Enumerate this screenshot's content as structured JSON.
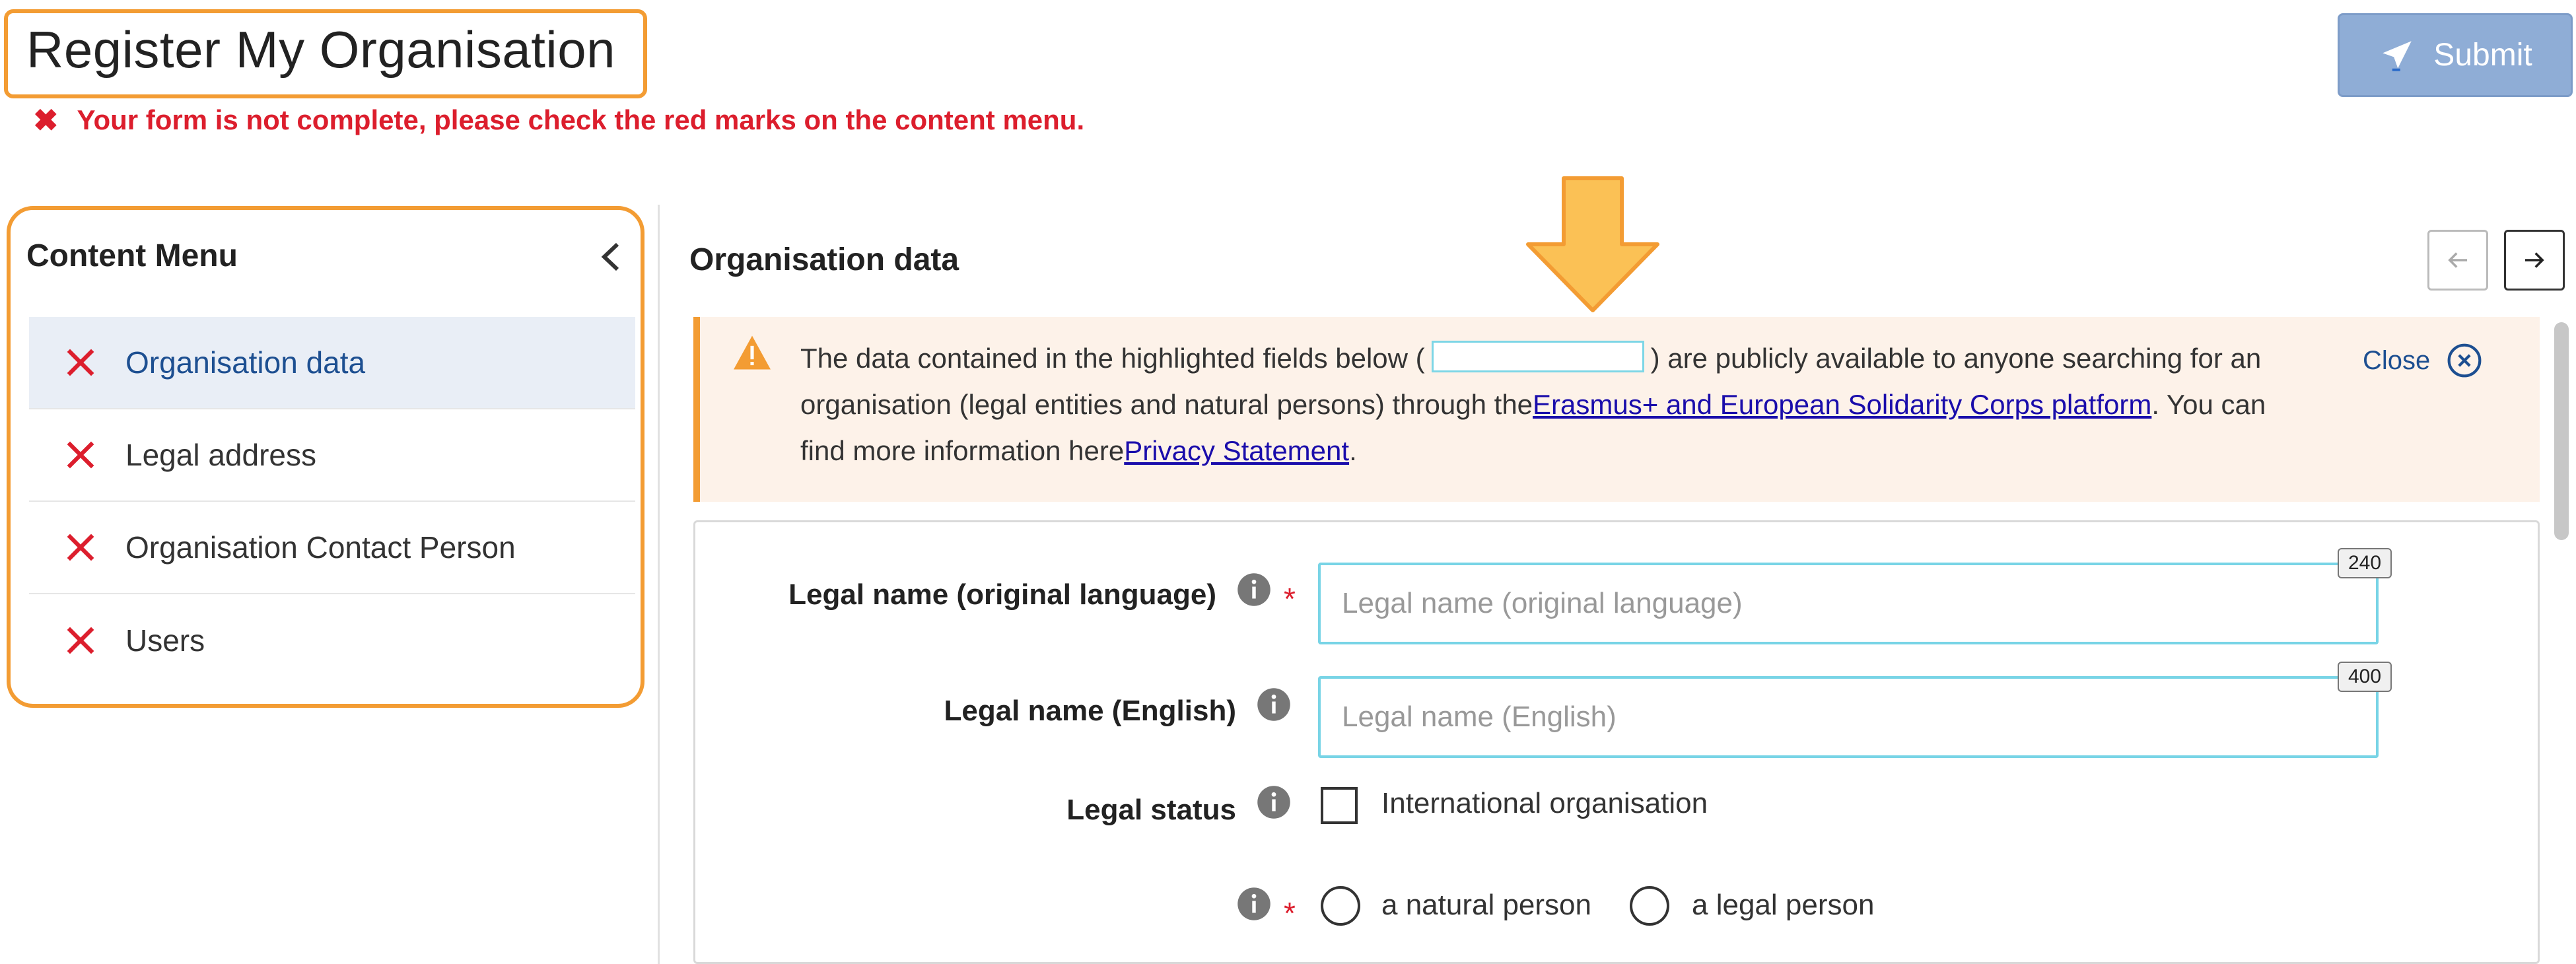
{
  "header": {
    "title": "Register My Organisation",
    "submit_label": "Submit",
    "error_message": "Your form is not complete, please check the red marks on the content menu."
  },
  "sidebar": {
    "title": "Content Menu",
    "items": [
      {
        "label": "Organisation data",
        "active": true
      },
      {
        "label": "Legal address",
        "active": false
      },
      {
        "label": "Organisation Contact Person",
        "active": false
      },
      {
        "label": "Users",
        "active": false
      }
    ]
  },
  "main": {
    "section_title": "Organisation data",
    "notice": {
      "text_before": "The data contained in the highlighted fields below (",
      "text_middle": ") are publicly available to anyone searching for an organisation (legal entities and natural persons) through the",
      "link_platform": "Erasmus+ and European Solidarity Corps platform",
      "text_after": ". You can find more information here",
      "link_privacy": "Privacy Statement",
      "text_end": ".",
      "close_label": "Close"
    },
    "form": {
      "legal_name_original": {
        "label": "Legal name (original language)",
        "placeholder": "Legal name (original language)",
        "counter": "240"
      },
      "legal_name_english": {
        "label": "Legal name (English)",
        "placeholder": "Legal name (English)",
        "counter": "400"
      },
      "legal_status": {
        "label": "Legal status",
        "checkbox_label": "International organisation"
      },
      "person_type": {
        "option_natural": "a natural person",
        "option_legal": "a legal person"
      }
    }
  },
  "colors": {
    "highlight_orange": "#f39c33",
    "error_red": "#dc1e2d",
    "submit_blue": "#8fadd6",
    "link_blue": "#1a0dab",
    "active_menu_bg": "#e9eef6",
    "field_highlight": "#78d4e6"
  },
  "icons": {
    "submit": "paper-plane-icon",
    "menu_item_status": "red-x-icon",
    "collapse": "chevron-left-icon",
    "prev": "arrow-left-icon",
    "next": "arrow-right-icon",
    "warning": "warning-triangle-icon",
    "close": "close-circle-icon",
    "info": "info-circle-icon",
    "callout": "down-arrow-annotation-icon"
  }
}
